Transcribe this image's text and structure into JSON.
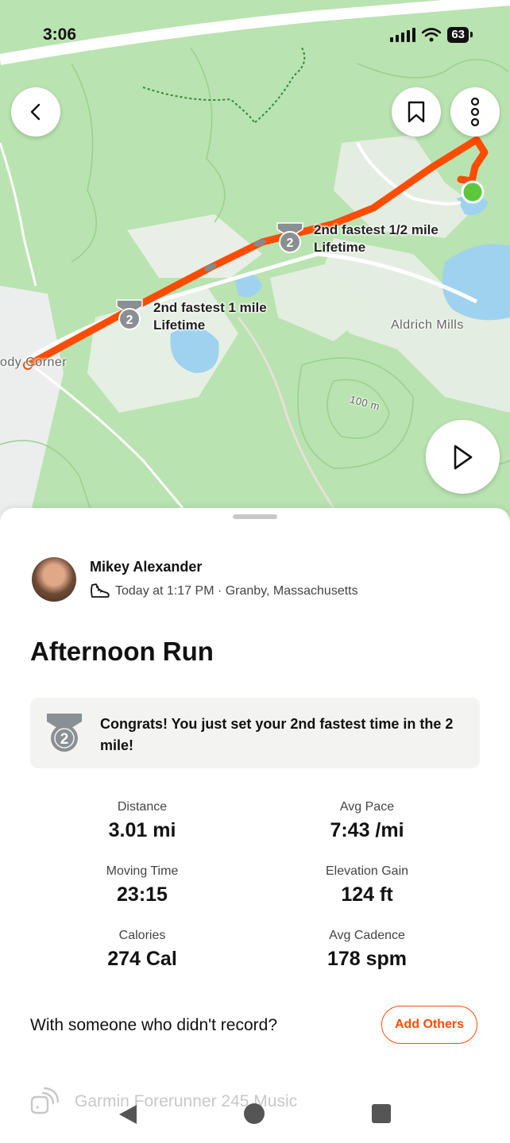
{
  "status_bar": {
    "time": "3:06",
    "battery": "63"
  },
  "map": {
    "labels": {
      "left_place": "ody Corner",
      "right_place": "Aldrich Mills",
      "contour": "100 m"
    },
    "segments": [
      {
        "rank": "2",
        "line1": "2nd fastest 1/2 mile",
        "line2": "Lifetime"
      },
      {
        "rank": "2",
        "line1": "2nd fastest 1 mile",
        "line2": "Lifetime"
      }
    ],
    "colors": {
      "route": "#fc4c02",
      "end_marker": "#5ac83a"
    }
  },
  "buttons": {
    "back": "chevron-left-icon",
    "bookmark": "bookmark-icon",
    "more": "more-vertical-icon",
    "play": "play-icon"
  },
  "activity": {
    "athlete": "Mikey Alexander",
    "meta": "Today at 1:17 PM · Granby, Massachusetts",
    "title": "Afternoon Run",
    "congrats": {
      "rank": "2",
      "text": "Congrats! You just set your 2nd fastest time in the 2 mile!"
    },
    "stats": [
      {
        "label": "Distance",
        "value": "3.01 mi"
      },
      {
        "label": "Avg Pace",
        "value": "7:43 /mi"
      },
      {
        "label": "Moving Time",
        "value": "23:15"
      },
      {
        "label": "Elevation Gain",
        "value": "124 ft"
      },
      {
        "label": "Calories",
        "value": "274 Cal"
      },
      {
        "label": "Avg Cadence",
        "value": "178 spm"
      }
    ],
    "with_others": {
      "question": "With someone who didn't record?",
      "button": "Add Others"
    },
    "device": "Garmin Forerunner 245 Music"
  },
  "colors": {
    "accent": "#fc4c02"
  }
}
